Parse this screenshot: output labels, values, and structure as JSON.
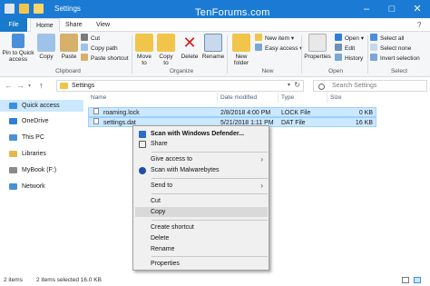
{
  "window": {
    "title": "Settings",
    "watermark": "TenForums.com",
    "minimize": "–",
    "maximize": "□",
    "close": "✕"
  },
  "tabs": {
    "file": "File",
    "home": "Home",
    "share": "Share",
    "view": "View"
  },
  "ribbon": {
    "clipboard": {
      "pin": "Pin to Quick access",
      "copy": "Copy",
      "paste": "Paste",
      "cut": "Cut",
      "copy_path": "Copy path",
      "paste_shortcut": "Paste shortcut",
      "label": "Clipboard"
    },
    "organize": {
      "move_to": "Move to",
      "copy_to": "Copy to",
      "delete": "Delete",
      "rename": "Rename",
      "label": "Organize"
    },
    "new": {
      "new_folder": "New folder",
      "new_item": "New item",
      "easy_access": "Easy access",
      "label": "New"
    },
    "open": {
      "properties": "Properties",
      "open": "Open",
      "edit": "Edit",
      "history": "History",
      "label": "Open"
    },
    "select": {
      "select_all": "Select all",
      "select_none": "Select none",
      "invert": "Invert selection",
      "label": "Select"
    }
  },
  "address": {
    "path": "Settings",
    "search_placeholder": "Search Settings",
    "back": "←",
    "forward": "→",
    "up": "↑",
    "refresh": "↻"
  },
  "nav": [
    {
      "label": "Quick access",
      "color": "#3a8ee6"
    },
    {
      "label": "OneDrive",
      "color": "#2f7fd8"
    },
    {
      "label": "This PC",
      "color": "#4a90d9"
    },
    {
      "label": "Libraries",
      "color": "#e6b84a"
    },
    {
      "label": "MyBook (F:)",
      "color": "#8a8a8a"
    },
    {
      "label": "Network",
      "color": "#4a90d9"
    }
  ],
  "columns": {
    "name": "Name",
    "date": "Date modified",
    "type": "Type",
    "size": "Size"
  },
  "files": [
    {
      "name": "roaming.lock",
      "date": "2/8/2018 4:00 PM",
      "type": "LOCK File",
      "size": "0 KB"
    },
    {
      "name": "settings.dat",
      "date": "5/21/2018 1:11 PM",
      "type": "DAT File",
      "size": "16 KB"
    }
  ],
  "context_menu": {
    "scan_defender": "Scan with Windows Defender...",
    "share": "Share",
    "give_access": "Give access to",
    "scan_malwarebytes": "Scan with Malwarebytes",
    "send_to": "Send to",
    "cut": "Cut",
    "copy": "Copy",
    "create_shortcut": "Create shortcut",
    "delete": "Delete",
    "rename": "Rename",
    "properties": "Properties",
    "arrow": "›"
  },
  "status": {
    "items": "2 items",
    "selected": "2 items selected  16.0 KB"
  },
  "colors": {
    "accent": "#1979ca",
    "selection": "#cce8ff"
  }
}
